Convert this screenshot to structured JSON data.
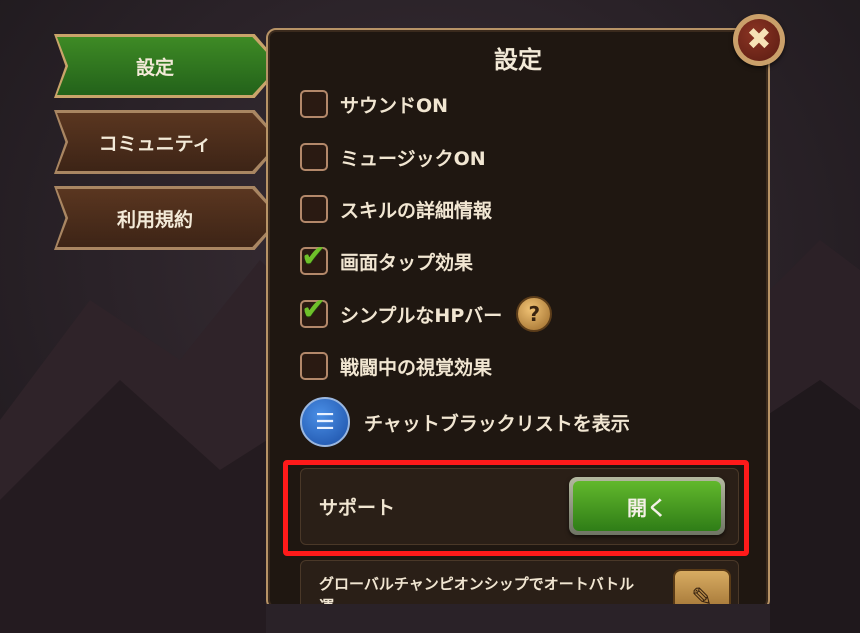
{
  "tabs": [
    {
      "label": "設定",
      "active": true
    },
    {
      "label": "コミュニティ",
      "active": false
    },
    {
      "label": "利用規約",
      "active": false
    }
  ],
  "panel": {
    "title": "設定",
    "close_icon": "close-icon"
  },
  "options": [
    {
      "label": "サウンドON",
      "checked": false
    },
    {
      "label": "ミュージックON",
      "checked": false
    },
    {
      "label": "スキルの詳細情報",
      "checked": false
    },
    {
      "label": "画面タップ効果",
      "checked": true
    },
    {
      "label": "シンプルなHPバー",
      "checked": true,
      "help_icon": "?"
    },
    {
      "label": "戦闘中の視覚効果",
      "checked": false
    }
  ],
  "chat_blacklist": {
    "label": "チャットブラックリストを表示",
    "icon": "list-icon"
  },
  "support": {
    "label": "サポート",
    "button_label": "開く"
  },
  "global_auto": {
    "label": "グローバルチャンピオンシップでオートバトル",
    "continued": "運"
  },
  "colors": {
    "accent_green": "#3e8a25",
    "highlight_red": "#ff1a1a",
    "panel_border": "#b79366"
  }
}
